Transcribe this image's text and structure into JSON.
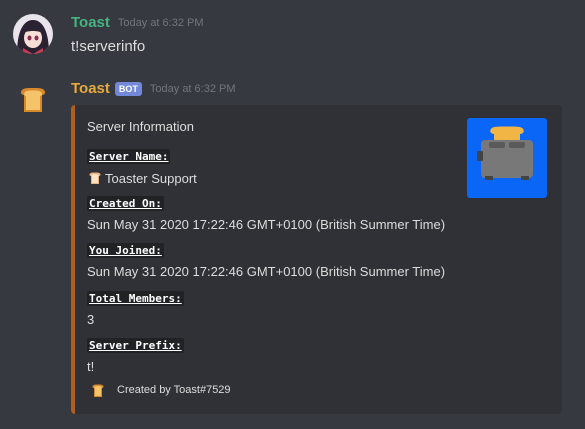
{
  "messages": [
    {
      "username": "Toast",
      "timestamp": "Today at 6:32 PM",
      "content": "t!serverinfo",
      "avatar": "anime-avatar",
      "name_color": "#43b581"
    },
    {
      "username": "Toast",
      "bot_tag": "BOT",
      "timestamp": "Today at 6:32 PM",
      "avatar": "toast-icon",
      "name_color": "#e8a93a",
      "embed": {
        "accent_color": "#ad5e21",
        "title": "Server Information",
        "thumbnail": "toaster-icon",
        "thumbnail_bg": "#0a66f7",
        "fields": [
          {
            "name": "Server Name:",
            "value": "Toaster Support",
            "icon": "bread-icon"
          },
          {
            "name": "Created On:",
            "value": "Sun May 31 2020 17:22:46 GMT+0100 (British Summer Time)"
          },
          {
            "name": "You Joined:",
            "value": "Sun May 31 2020 17:22:46 GMT+0100 (British Summer Time)"
          },
          {
            "name": "Total Members:",
            "value": "3"
          },
          {
            "name": "Server Prefix:",
            "value": "t!"
          }
        ],
        "footer": {
          "text": "Created by Toast#7529",
          "icon": "toast-icon"
        }
      }
    }
  ]
}
